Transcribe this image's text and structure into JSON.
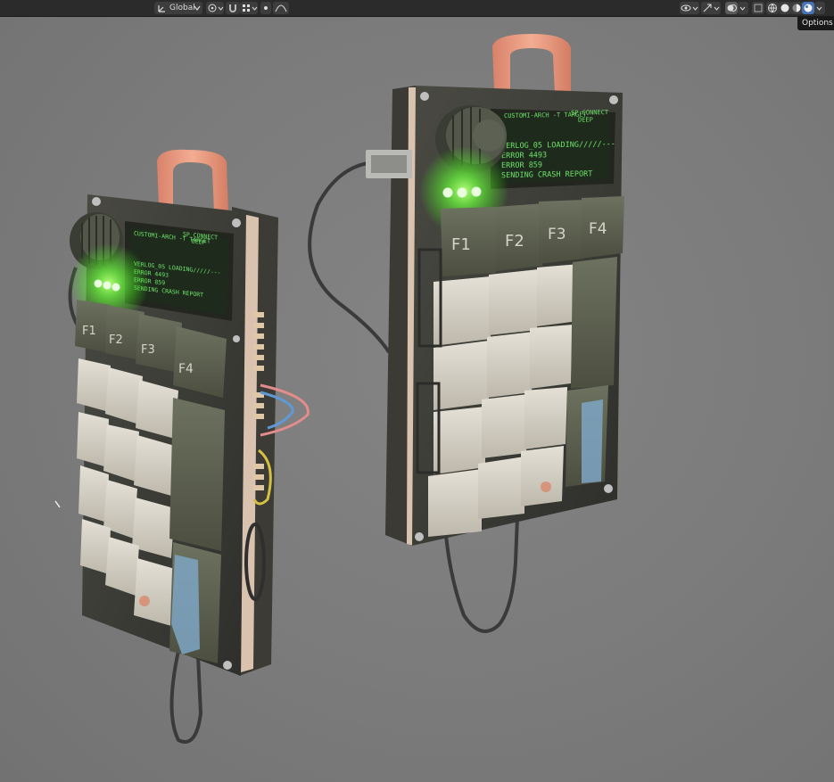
{
  "header": {
    "transform_orientation": "Global",
    "options_tooltip": "Options"
  },
  "left_device": {
    "screen_lines": [
      "CUSTOMI-ARCH -T TARGET",
      "SP CONNECT",
      "DEEP",
      "VERLOG_05 LOADING/////---",
      "ERROR 4493",
      "ERROR 859",
      "SENDING CRASH REPORT"
    ],
    "fkeys": [
      "F1",
      "F2",
      "F3",
      "F4"
    ]
  },
  "right_device": {
    "screen_lines": [
      "CUSTOMI-ARCH -T TARGET",
      "SP CONNECT",
      "DEEP",
      "VERLOG_05 LOADING/////---",
      "ERROR 4493",
      "ERROR 859",
      "SENDING CRASH REPORT"
    ],
    "fkeys": [
      "F1",
      "F2",
      "F3",
      "F4"
    ]
  },
  "colors": {
    "background": "#7c7c7c",
    "header": "#2b2b2b",
    "led_green": "#7dff5a",
    "screen_text": "#6ee06a",
    "keycap_white": "#d8d3c7",
    "keycap_dark": "#5f6351",
    "strap": "#e89a7c"
  }
}
